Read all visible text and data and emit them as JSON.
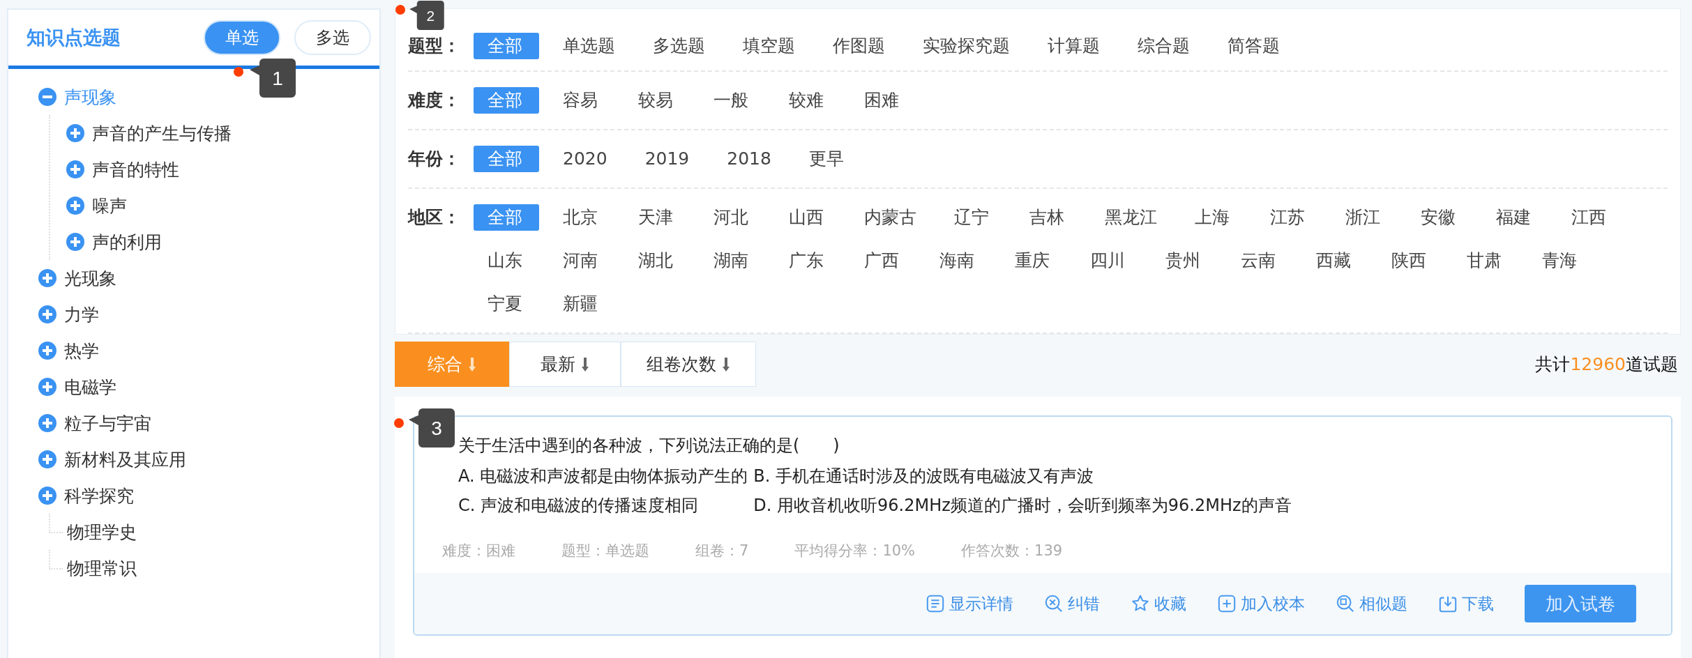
{
  "sidebar": {
    "title": "知识点选题",
    "marker": "1",
    "modes": [
      {
        "label": "单选",
        "selected": true
      },
      {
        "label": "多选",
        "selected": false
      }
    ],
    "tree": [
      {
        "kind": "node",
        "label": "声现象",
        "expanded": true,
        "selected": true,
        "children": [
          {
            "kind": "node",
            "label": "声音的产生与传播",
            "expanded": false,
            "selected": false
          },
          {
            "kind": "node",
            "label": "声音的特性",
            "expanded": false,
            "selected": false
          },
          {
            "kind": "node",
            "label": "噪声",
            "expanded": false,
            "selected": false
          },
          {
            "kind": "node",
            "label": "声的利用",
            "expanded": false,
            "selected": false
          }
        ]
      },
      {
        "kind": "node",
        "label": "光现象",
        "expanded": false,
        "selected": false
      },
      {
        "kind": "node",
        "label": "力学",
        "expanded": false,
        "selected": false
      },
      {
        "kind": "node",
        "label": "热学",
        "expanded": false,
        "selected": false
      },
      {
        "kind": "node",
        "label": "电磁学",
        "expanded": false,
        "selected": false
      },
      {
        "kind": "node",
        "label": "粒子与宇宙",
        "expanded": false,
        "selected": false
      },
      {
        "kind": "node",
        "label": "新材料及其应用",
        "expanded": false,
        "selected": false
      },
      {
        "kind": "node",
        "label": "科学探究",
        "expanded": false,
        "selected": false
      },
      {
        "kind": "leaf",
        "label": "物理学史",
        "selected": false
      },
      {
        "kind": "leaf",
        "label": "物理常识",
        "selected": false
      }
    ]
  },
  "filters": {
    "marker": "2",
    "rows": [
      {
        "label": "题型：",
        "options": [
          {
            "label": "全部",
            "selected": true
          },
          {
            "label": "单选题",
            "selected": false
          },
          {
            "label": "多选题",
            "selected": false
          },
          {
            "label": "填空题",
            "selected": false
          },
          {
            "label": "作图题",
            "selected": false
          },
          {
            "label": "实验探究题",
            "selected": false
          },
          {
            "label": "计算题",
            "selected": false
          },
          {
            "label": "综合题",
            "selected": false
          },
          {
            "label": "简答题",
            "selected": false
          }
        ]
      },
      {
        "label": "难度：",
        "options": [
          {
            "label": "全部",
            "selected": true
          },
          {
            "label": "容易",
            "selected": false
          },
          {
            "label": "较易",
            "selected": false
          },
          {
            "label": "一般",
            "selected": false
          },
          {
            "label": "较难",
            "selected": false
          },
          {
            "label": "困难",
            "selected": false
          }
        ]
      },
      {
        "label": "年份：",
        "options": [
          {
            "label": "全部",
            "selected": true
          },
          {
            "label": "2020",
            "selected": false
          },
          {
            "label": "2019",
            "selected": false
          },
          {
            "label": "2018",
            "selected": false
          },
          {
            "label": "更早",
            "selected": false
          }
        ]
      },
      {
        "label": "地区：",
        "options": [
          {
            "label": "全部",
            "selected": true
          },
          {
            "label": "北京",
            "selected": false
          },
          {
            "label": "天津",
            "selected": false
          },
          {
            "label": "河北",
            "selected": false
          },
          {
            "label": "山西",
            "selected": false
          },
          {
            "label": "内蒙古",
            "selected": false
          },
          {
            "label": "辽宁",
            "selected": false
          },
          {
            "label": "吉林",
            "selected": false
          },
          {
            "label": "黑龙江",
            "selected": false
          },
          {
            "label": "上海",
            "selected": false
          },
          {
            "label": "江苏",
            "selected": false
          },
          {
            "label": "浙江",
            "selected": false
          },
          {
            "label": "安徽",
            "selected": false
          },
          {
            "label": "福建",
            "selected": false
          },
          {
            "label": "江西",
            "selected": false
          },
          {
            "label": "山东",
            "selected": false
          },
          {
            "label": "河南",
            "selected": false
          },
          {
            "label": "湖北",
            "selected": false
          },
          {
            "label": "湖南",
            "selected": false
          },
          {
            "label": "广东",
            "selected": false
          },
          {
            "label": "广西",
            "selected": false
          },
          {
            "label": "海南",
            "selected": false
          },
          {
            "label": "重庆",
            "selected": false
          },
          {
            "label": "四川",
            "selected": false
          },
          {
            "label": "贵州",
            "selected": false
          },
          {
            "label": "云南",
            "selected": false
          },
          {
            "label": "西藏",
            "selected": false
          },
          {
            "label": "陕西",
            "selected": false
          },
          {
            "label": "甘肃",
            "selected": false
          },
          {
            "label": "青海",
            "selected": false
          },
          {
            "label": "宁夏",
            "selected": false
          },
          {
            "label": "新疆",
            "selected": false
          }
        ]
      }
    ]
  },
  "sort": {
    "tabs": [
      {
        "label": "综合",
        "selected": true
      },
      {
        "label": "最新",
        "selected": false
      },
      {
        "label": "组卷次数",
        "selected": false
      }
    ],
    "total": {
      "prefix": "共计",
      "count": "12960",
      "suffix": "道试题"
    }
  },
  "question": {
    "marker": "3",
    "stem": "关于生活中遇到的各种波，下列说法正确的是(　　)",
    "options": [
      "A. 电磁波和声波都是由物体振动产生的",
      "B. 手机在通话时涉及的波既有电磁波又有声波",
      "C. 声波和电磁波的传播速度相同",
      "D. 用收音机收听96.2MHz频道的广播时，会听到频率为96.2MHz的声音"
    ],
    "meta": [
      "难度：困难",
      "题型：单选题",
      "组卷：7",
      "平均得分率：10%",
      "作答次数：139"
    ],
    "actions": [
      {
        "kind": "details",
        "label": "显示详情"
      },
      {
        "kind": "report",
        "label": "纠错"
      },
      {
        "kind": "favorite",
        "label": "收藏"
      },
      {
        "kind": "add",
        "label": "加入校本"
      },
      {
        "kind": "similar",
        "label": "相似题"
      },
      {
        "kind": "download",
        "label": "下载"
      }
    ],
    "add_button": "加入试卷"
  }
}
